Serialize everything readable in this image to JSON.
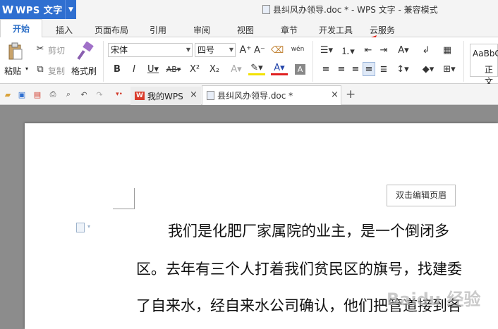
{
  "app": {
    "logo": "W",
    "title": "WPS 文字",
    "menu_arrow": "▼"
  },
  "window": {
    "title": "县纠风办领导.doc * - WPS 文字 - 兼容模式"
  },
  "tabs": [
    {
      "label": "开始"
    },
    {
      "label": "插入"
    },
    {
      "label": "页面布局"
    },
    {
      "label": "引用"
    },
    {
      "label": "审阅"
    },
    {
      "label": "视图"
    },
    {
      "label": "章节"
    },
    {
      "label": "开发工具"
    },
    {
      "label": "云服务"
    }
  ],
  "ribbon": {
    "paste": "粘贴",
    "cut": "剪切",
    "copy": "复制",
    "format_painter": "格式刷",
    "font_name": "宋体",
    "font_size": "四号",
    "style_preview": "AaBbC",
    "style_name": "正文"
  },
  "doc_tabs": [
    {
      "label": "我的WPS"
    },
    {
      "label": "县纠风办领导.doc *"
    }
  ],
  "document": {
    "header_button": "双击编辑页眉",
    "lines": [
      "我们是化肥厂家属院的业主，是一个倒闭多",
      "区。去年有三个人打着我们贫民区的旗号，找建委",
      "了自来水，经自来水公司确认，他们把管道接到各"
    ],
    "watermark": "Baidu 经验"
  },
  "colors": {
    "accent": "#2f6fd0",
    "arrow": "#e0261b",
    "canvas": "#8c8c8c"
  }
}
